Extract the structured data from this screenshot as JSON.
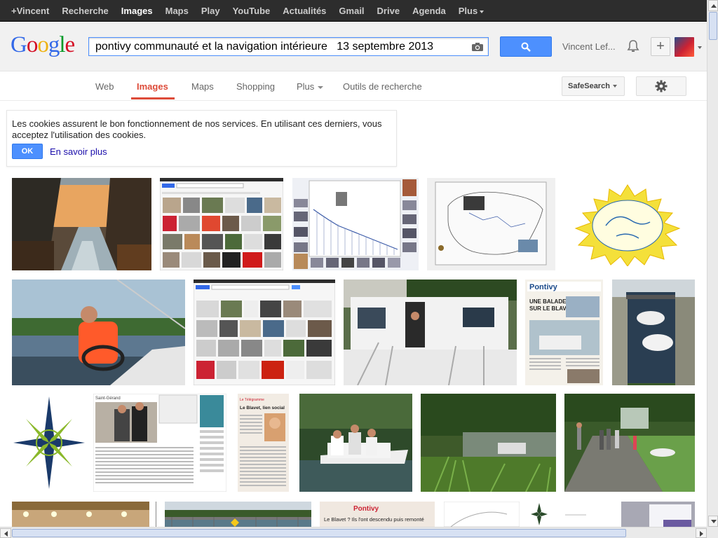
{
  "topbar": {
    "links": [
      "+Vincent",
      "Recherche",
      "Images",
      "Maps",
      "Play",
      "YouTube",
      "Actualités",
      "Gmail",
      "Drive",
      "Agenda",
      "Plus"
    ],
    "active": "Images"
  },
  "header": {
    "logo_letters": [
      {
        "ch": "G",
        "color": "#3369e8"
      },
      {
        "ch": "o",
        "color": "#d50f25"
      },
      {
        "ch": "o",
        "color": "#eeb211"
      },
      {
        "ch": "g",
        "color": "#3369e8"
      },
      {
        "ch": "l",
        "color": "#009925"
      },
      {
        "ch": "e",
        "color": "#d50f25"
      }
    ],
    "search_query": "pontivy communauté et la navigation intérieure   13 septembre 2013",
    "user_name": "Vincent Lef..."
  },
  "nav": {
    "tabs": [
      "Web",
      "Images",
      "Maps",
      "Shopping",
      "Plus",
      "Outils de recherche"
    ],
    "active": "Images",
    "safesearch_label": "SafeSearch"
  },
  "cookie": {
    "text": "Les cookies assurent le bon fonctionnement de nos services. En utilisant ces derniers, vous acceptez l'utilisation des cookies.",
    "ok_label": "OK",
    "more_label": "En savoir plus"
  },
  "results": [
    {
      "name": "canal-autumn-photo",
      "kind": "photo-canal-autumn"
    },
    {
      "name": "google-screenshot-1",
      "kind": "screenshot-grid"
    },
    {
      "name": "canal-profile-chart",
      "kind": "profile-chart"
    },
    {
      "name": "map-brittany",
      "kind": "map"
    },
    {
      "name": "esprit-canal-logo",
      "kind": "sun-logo"
    },
    {
      "name": "boat-driver-photo",
      "kind": "photo-boat-driver"
    },
    {
      "name": "google-screenshot-2",
      "kind": "screenshot-grid"
    },
    {
      "name": "tourism-boat-photo",
      "kind": "photo-white-boat"
    },
    {
      "name": "newspaper-balade-blavet",
      "kind": "newspaper"
    },
    {
      "name": "lock-boats-photo",
      "kind": "photo-lock"
    },
    {
      "name": "compass-rose-logo",
      "kind": "compass"
    },
    {
      "name": "webpage-article",
      "kind": "webpage"
    },
    {
      "name": "newspaper-le-blavet",
      "kind": "newspaper2"
    },
    {
      "name": "motorboat-photo",
      "kind": "photo-motorboat"
    },
    {
      "name": "river-boat-photo",
      "kind": "photo-river"
    },
    {
      "name": "towpath-people-photo",
      "kind": "photo-towpath"
    },
    {
      "name": "interior-photo",
      "kind": "photo-interior"
    },
    {
      "name": "bridge-photo",
      "kind": "photo-bridge"
    },
    {
      "name": "newspaper-pontivy",
      "kind": "newspaper3"
    },
    {
      "name": "sketch-image",
      "kind": "sketch"
    },
    {
      "name": "compass-small",
      "kind": "compass-small"
    },
    {
      "name": "document-white",
      "kind": "doc"
    },
    {
      "name": "grey-photo",
      "kind": "grey"
    }
  ],
  "thumb_text": {
    "pontivy": "Pontivy",
    "balade": "UNE BALADE SUR LE BLAVET",
    "blavet": "Le Blavet, lien social",
    "pontivy3": "Pontivy",
    "blavet3": "Le Blavet ? Ils l'ont descendu puis remonté"
  }
}
